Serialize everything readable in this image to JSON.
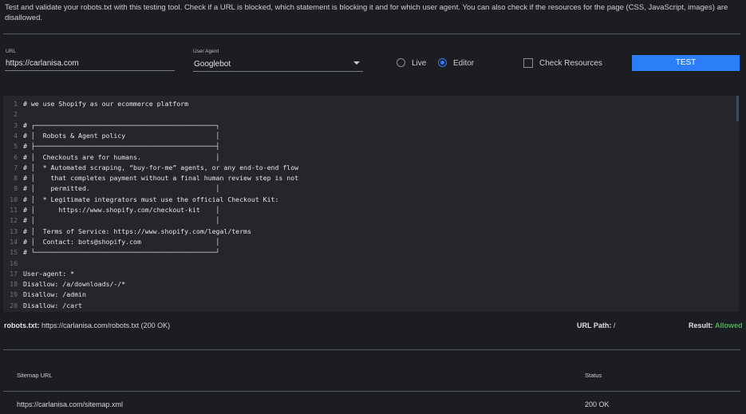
{
  "intro": "Test and validate your robots.txt with this testing tool. Check if a URL is blocked, which statement is blocking it and for which user agent. You can also check if the resources for the page (CSS, JavaScript, images) are disallowed.",
  "form": {
    "url_label": "URL",
    "url_value": "https://carlanisa.com",
    "agent_label": "User Agent",
    "agent_value": "Googlebot",
    "mode_live": "Live",
    "mode_editor": "Editor",
    "selected_mode": "Editor",
    "check_resources": "Check Resources",
    "check_resources_checked": false,
    "test_button": "TEST"
  },
  "editor": {
    "lines": [
      {
        "n": "1",
        "text": "# we use Shopify as our ecommerce platform"
      },
      {
        "n": "2",
        "text": ""
      },
      {
        "n": "3",
        "text": "# ┌──────────────────────────────────────────────┐"
      },
      {
        "n": "4",
        "text": "# │  Robots & Agent policy                       │"
      },
      {
        "n": "5",
        "text": "# ├──────────────────────────────────────────────┤"
      },
      {
        "n": "6",
        "text": "# │  Checkouts are for humans.                   │"
      },
      {
        "n": "7",
        "text": "# │  * Automated scraping, “buy-for-me” agents, or any end-to-end flow"
      },
      {
        "n": "8",
        "text": "# │    that completes payment without a final human review step is not"
      },
      {
        "n": "9",
        "text": "# │    permitted.                                │"
      },
      {
        "n": "10",
        "text": "# │  * Legitimate integrators must use the official Checkout Kit:"
      },
      {
        "n": "11",
        "text": "# │      https://www.shopify.com/checkout-kit    │"
      },
      {
        "n": "12",
        "text": "# │                                              │"
      },
      {
        "n": "13",
        "text": "# │  Terms of Service: https://www.shopify.com/legal/terms"
      },
      {
        "n": "14",
        "text": "# │  Contact: bots@shopify.com                   │"
      },
      {
        "n": "15",
        "text": "# └──────────────────────────────────────────────┘"
      },
      {
        "n": "16",
        "text": ""
      },
      {
        "n": "17",
        "text": "User-agent: *"
      },
      {
        "n": "18",
        "text": "Disallow: /a/downloads/-/*"
      },
      {
        "n": "19",
        "text": "Disallow: /admin"
      },
      {
        "n": "20",
        "text": "Disallow: /cart"
      }
    ]
  },
  "status": {
    "robots_label": "robots.txt:",
    "robots_value": "https://carlanisa.com/robots.txt (200 OK)",
    "path_label": "URL Path:",
    "path_value": "/",
    "result_label": "Result:",
    "result_value": "Allowed"
  },
  "sitemaps": {
    "headers": [
      "Sitemap URL",
      "Status"
    ],
    "rows": [
      [
        "https://carlanisa.com/sitemap.xml",
        "200 OK"
      ]
    ]
  },
  "colors": {
    "accent": "#2d7ff9",
    "allowed": "#4caf50",
    "background": "#1c1d22",
    "editor_bg": "#25262c"
  }
}
